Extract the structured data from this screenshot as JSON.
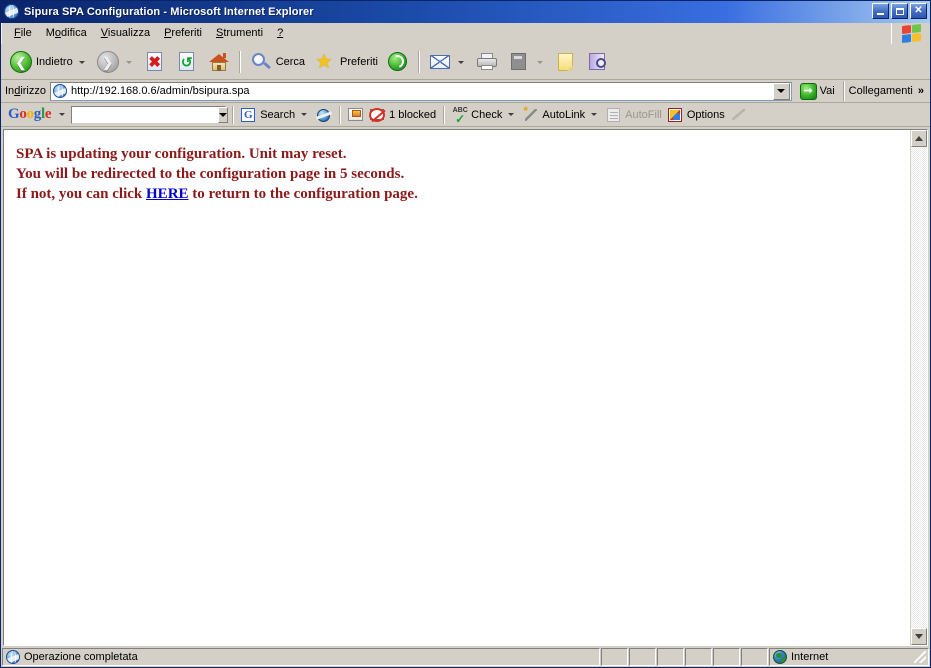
{
  "window": {
    "title": "Sipura SPA Configuration - Microsoft Internet Explorer",
    "title_icon": "ie-globe-icon",
    "minimize_label": "_",
    "maximize_label": "□",
    "close_label": "✕"
  },
  "menu": {
    "items": [
      {
        "label": "File",
        "accel": "F"
      },
      {
        "label": "Modifica",
        "accel": "M"
      },
      {
        "label": "Visualizza",
        "accel": "V"
      },
      {
        "label": "Preferiti",
        "accel": "P"
      },
      {
        "label": "Strumenti",
        "accel": "S"
      },
      {
        "label": "?",
        "accel": "?"
      }
    ],
    "brand_icon": "windows-flag-icon"
  },
  "toolbar": {
    "back_label": "Indietro",
    "back_icon": "back-arrow-icon",
    "forward_label": "",
    "forward_icon": "forward-arrow-icon",
    "stop_icon": "stop-icon",
    "refresh_icon": "refresh-icon",
    "home_icon": "home-icon",
    "search_label": "Cerca",
    "search_icon": "magnifier-icon",
    "favorites_label": "Preferiti",
    "favorites_icon": "star-icon",
    "media_icon": "media-icon",
    "mail_icon": "mail-icon",
    "print_icon": "printer-icon",
    "edit_icon": "edit-page-icon",
    "notes_icon": "notes-icon",
    "research_icon": "research-icon"
  },
  "address": {
    "label": "Indirizzo",
    "icon": "ie-globe-icon",
    "url": "http://192.168.0.6/admin/bsipura.spa",
    "dropdown_icon": "chevron-down-icon",
    "go_label": "Vai",
    "go_icon": "go-arrow-icon",
    "links_label": "Collegamenti",
    "links_chevron": "»"
  },
  "google_toolbar": {
    "logo": {
      "g1": "G",
      "o1": "o",
      "o2": "o",
      "g2": "g",
      "l": "l",
      "e": "e"
    },
    "logo_dropdown_icon": "chevron-down-icon",
    "search_value": "",
    "search_placeholder": "",
    "search_dropdown_icon": "chevron-down-icon",
    "search_button_label": "Search",
    "search_button_icon": "google-g-icon",
    "globe_icon": "globe-icon",
    "popup_blocker_icon": "popup-blocker-icon",
    "blocked_label": "1 blocked",
    "blocked_icon": "blocked-popup-icon",
    "check_label": "Check",
    "check_icon": "spellcheck-icon",
    "autolink_label": "AutoLink",
    "autolink_icon": "magic-wand-icon",
    "autofill_label": "AutoFill",
    "autofill_icon": "autofill-icon",
    "options_label": "Options",
    "options_icon": "options-icon",
    "highlight_icon": "highlighter-icon"
  },
  "page": {
    "line1": "SPA is updating your configuration. Unit may reset.",
    "line2": "You will be redirected to the configuration page in 5 seconds.",
    "line3_before": "If not, you can click ",
    "line3_link": "HERE",
    "line3_after": " to return to the configuration page.",
    "text_color": "#8b1a1a",
    "link_color": "#0000cc"
  },
  "scrollbar": {
    "up_icon": "scroll-up-arrow-icon",
    "down_icon": "scroll-down-arrow-icon"
  },
  "statusbar": {
    "message": "Operazione completata",
    "message_icon": "ie-globe-icon",
    "zone": "Internet",
    "zone_icon": "internet-zone-globe-icon"
  }
}
